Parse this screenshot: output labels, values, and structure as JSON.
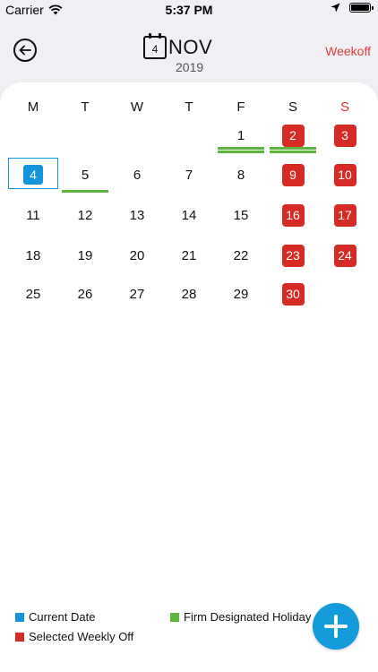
{
  "status_bar": {
    "carrier": "Carrier",
    "time": "5:37 PM"
  },
  "header": {
    "calendar_icon_day": "4",
    "month": "NOV",
    "year": "2019",
    "weekoff_label": "Weekoff"
  },
  "calendar": {
    "weekdays": [
      {
        "label": "M"
      },
      {
        "label": "T"
      },
      {
        "label": "W"
      },
      {
        "label": "T"
      },
      {
        "label": "F"
      },
      {
        "label": "S"
      },
      {
        "label": "S"
      }
    ],
    "rows": [
      [
        null,
        null,
        null,
        null,
        {
          "d": "1",
          "holiday": true
        },
        {
          "d": "2",
          "weekoff": true,
          "holiday": true
        },
        {
          "d": "3",
          "weekoff": true
        }
      ],
      [
        {
          "d": "4",
          "today": true
        },
        {
          "d": "5",
          "holiday": true
        },
        {
          "d": "6"
        },
        {
          "d": "7"
        },
        {
          "d": "8"
        },
        {
          "d": "9",
          "weekoff": true
        },
        {
          "d": "10",
          "weekoff": true
        }
      ],
      [
        {
          "d": "11"
        },
        {
          "d": "12"
        },
        {
          "d": "13"
        },
        {
          "d": "14"
        },
        {
          "d": "15"
        },
        {
          "d": "16",
          "weekoff": true
        },
        {
          "d": "17",
          "weekoff": true
        }
      ],
      [
        {
          "d": "18"
        },
        {
          "d": "19"
        },
        {
          "d": "20"
        },
        {
          "d": "21"
        },
        {
          "d": "22"
        },
        {
          "d": "23",
          "weekoff": true
        },
        {
          "d": "24",
          "weekoff": true
        }
      ],
      [
        {
          "d": "25"
        },
        {
          "d": "26"
        },
        {
          "d": "27"
        },
        {
          "d": "28"
        },
        {
          "d": "29"
        },
        {
          "d": "30",
          "weekoff": true
        },
        null
      ]
    ]
  },
  "legend": {
    "current_date": "Current Date",
    "firm_holiday": "Firm Designated Holiday",
    "weekly_off": "Selected Weekly Off"
  },
  "colors": {
    "current": "#1593db",
    "holiday": "#5cb63c",
    "weekoff": "#d62b24"
  }
}
